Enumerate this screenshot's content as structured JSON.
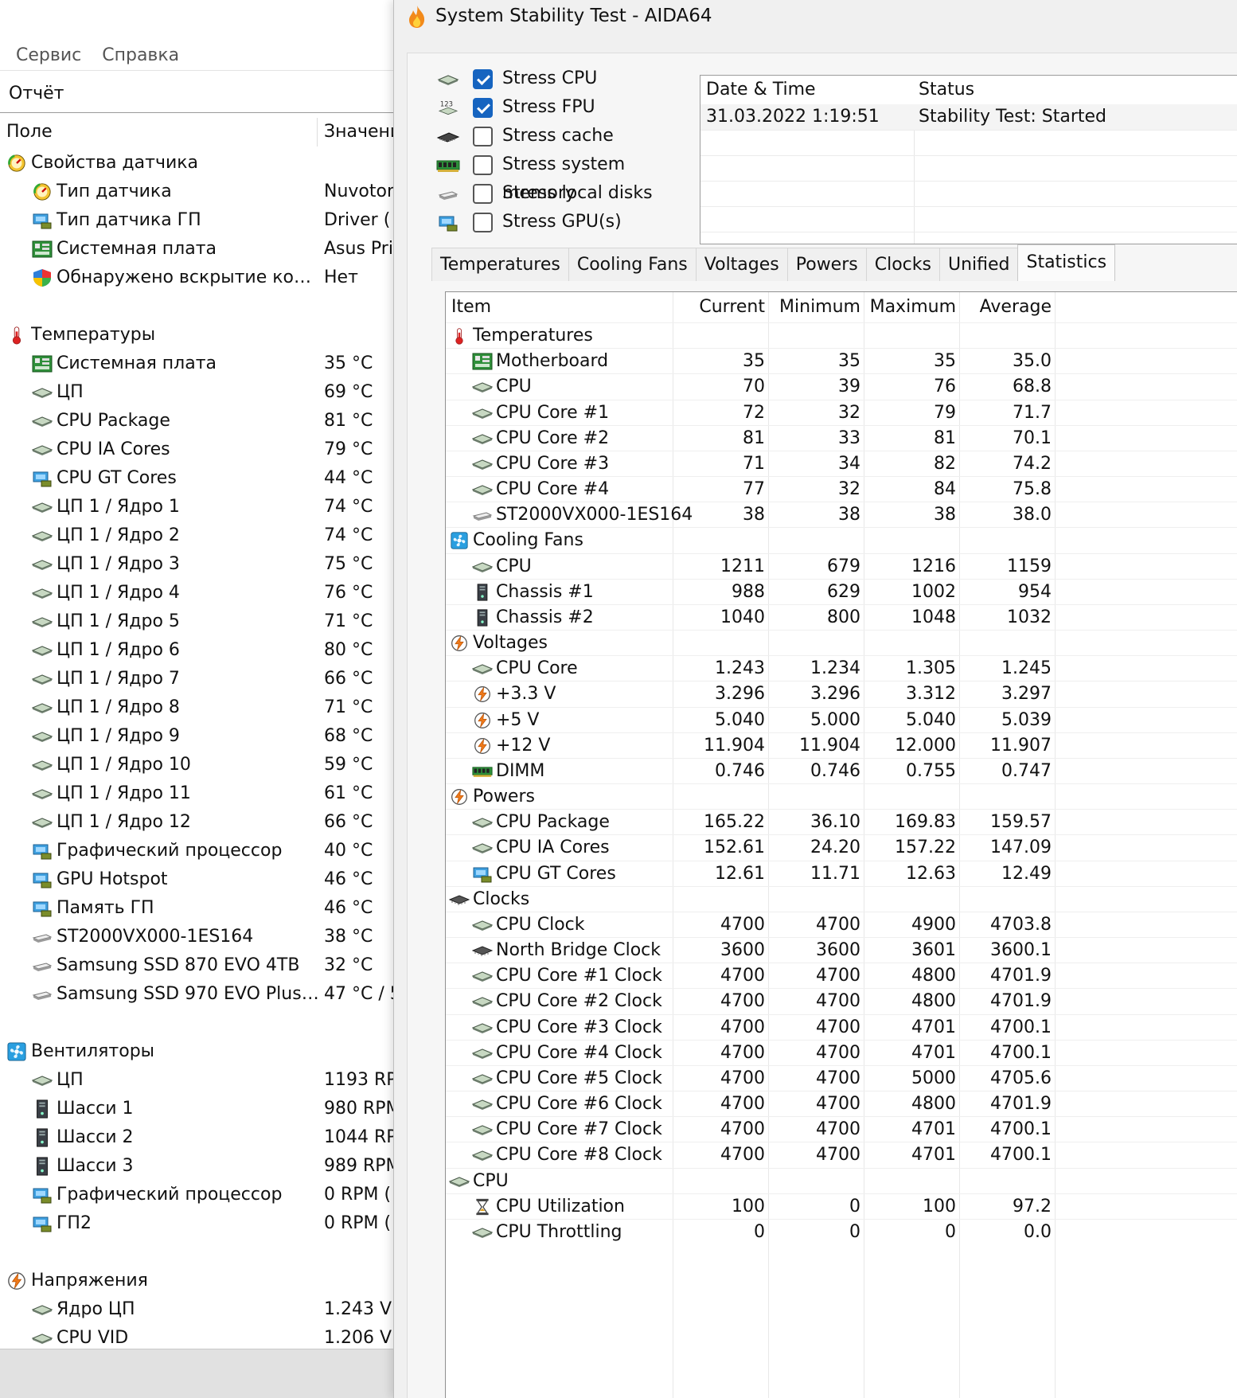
{
  "left": {
    "menu": [
      "Сервис",
      "Справка"
    ],
    "report_label": "Отчёт",
    "col_field": "Поле",
    "col_value": "Значени",
    "rows": [
      {
        "type": "group",
        "icon": "sensor-icon",
        "label": "Свойства датчика",
        "value": ""
      },
      {
        "type": "item",
        "icon": "sensor-icon",
        "label": "Тип датчика",
        "value": "Nuvoton"
      },
      {
        "type": "item",
        "icon": "gpu-icon",
        "label": "Тип датчика ГП",
        "value": "Driver  ("
      },
      {
        "type": "item",
        "icon": "motherboard-icon",
        "label": "Системная плата",
        "value": "Asus Pri"
      },
      {
        "type": "item",
        "icon": "shield-icon",
        "label": "Обнаружено вскрытие кор...",
        "value": "Нет"
      },
      {
        "type": "gap"
      },
      {
        "type": "group",
        "icon": "thermometer-icon",
        "label": "Температуры",
        "value": ""
      },
      {
        "type": "item",
        "icon": "motherboard-icon",
        "label": "Системная плата",
        "value": "35 °C"
      },
      {
        "type": "item",
        "icon": "cpu-icon",
        "label": "ЦП",
        "value": "69 °C"
      },
      {
        "type": "item",
        "icon": "cpu-icon",
        "label": "CPU Package",
        "value": "81 °C"
      },
      {
        "type": "item",
        "icon": "cpu-icon",
        "label": "CPU IA Cores",
        "value": "79 °C"
      },
      {
        "type": "item",
        "icon": "gpu-icon",
        "label": "CPU GT Cores",
        "value": "44 °C"
      },
      {
        "type": "item",
        "icon": "cpu-icon",
        "label": "ЦП 1 / Ядро 1",
        "value": "74 °C"
      },
      {
        "type": "item",
        "icon": "cpu-icon",
        "label": "ЦП 1 / Ядро 2",
        "value": "74 °C"
      },
      {
        "type": "item",
        "icon": "cpu-icon",
        "label": "ЦП 1 / Ядро 3",
        "value": "75 °C"
      },
      {
        "type": "item",
        "icon": "cpu-icon",
        "label": "ЦП 1 / Ядро 4",
        "value": "76 °C"
      },
      {
        "type": "item",
        "icon": "cpu-icon",
        "label": "ЦП 1 / Ядро 5",
        "value": "71 °C"
      },
      {
        "type": "item",
        "icon": "cpu-icon",
        "label": "ЦП 1 / Ядро 6",
        "value": "80 °C"
      },
      {
        "type": "item",
        "icon": "cpu-icon",
        "label": "ЦП 1 / Ядро 7",
        "value": "66 °C"
      },
      {
        "type": "item",
        "icon": "cpu-icon",
        "label": "ЦП 1 / Ядро 8",
        "value": "71 °C"
      },
      {
        "type": "item",
        "icon": "cpu-icon",
        "label": "ЦП 1 / Ядро 9",
        "value": "68 °C"
      },
      {
        "type": "item",
        "icon": "cpu-icon",
        "label": "ЦП 1 / Ядро 10",
        "value": "59 °C"
      },
      {
        "type": "item",
        "icon": "cpu-icon",
        "label": "ЦП 1 / Ядро 11",
        "value": "61 °C"
      },
      {
        "type": "item",
        "icon": "cpu-icon",
        "label": "ЦП 1 / Ядро 12",
        "value": "66 °C"
      },
      {
        "type": "item",
        "icon": "gpu-icon",
        "label": "Графический процессор",
        "value": "40 °C"
      },
      {
        "type": "item",
        "icon": "gpu-icon",
        "label": "GPU Hotspot",
        "value": "46 °C"
      },
      {
        "type": "item",
        "icon": "gpu-icon",
        "label": "Память ГП",
        "value": "46 °C"
      },
      {
        "type": "item",
        "icon": "disk-icon",
        "label": "ST2000VX000-1ES164",
        "value": "38 °C"
      },
      {
        "type": "item",
        "icon": "disk-icon",
        "label": "Samsung SSD 870 EVO 4TB",
        "value": "32 °C"
      },
      {
        "type": "item",
        "icon": "disk-icon",
        "label": "Samsung SSD 970 EVO Plus ...",
        "value": "47 °C / 5"
      },
      {
        "type": "gap"
      },
      {
        "type": "group",
        "icon": "fan-icon",
        "label": "Вентиляторы",
        "value": ""
      },
      {
        "type": "item",
        "icon": "cpu-icon",
        "label": "ЦП",
        "value": "1193 RP"
      },
      {
        "type": "item",
        "icon": "chassis-icon",
        "label": "Шасси 1",
        "value": "980 RPM"
      },
      {
        "type": "item",
        "icon": "chassis-icon",
        "label": "Шасси 2",
        "value": "1044 RP"
      },
      {
        "type": "item",
        "icon": "chassis-icon",
        "label": "Шасси 3",
        "value": "989 RPM"
      },
      {
        "type": "item",
        "icon": "gpu-icon",
        "label": "Графический процессор",
        "value": "0 RPM  ("
      },
      {
        "type": "item",
        "icon": "gpu-icon",
        "label": "ГП2",
        "value": "0 RPM  ("
      },
      {
        "type": "gap"
      },
      {
        "type": "group",
        "icon": "voltage-icon",
        "label": "Напряжения",
        "value": ""
      },
      {
        "type": "item",
        "icon": "cpu-icon",
        "label": "Ядро ЦП",
        "value": "1.243 V"
      },
      {
        "type": "item",
        "icon": "cpu-icon",
        "label": "CPU VID",
        "value": "1.206 V"
      }
    ]
  },
  "window": {
    "title": "System Stability Test - AIDA64",
    "stress": [
      {
        "icon": "cpu-icon",
        "label": "Stress CPU",
        "checked": true
      },
      {
        "icon": "fpu-icon",
        "label": "Stress FPU",
        "checked": true
      },
      {
        "icon": "cache-icon",
        "label": "Stress cache",
        "checked": false
      },
      {
        "icon": "memory-icon",
        "label": "Stress system memory",
        "checked": false
      },
      {
        "icon": "disk-icon",
        "label": "Stress local disks",
        "checked": false
      },
      {
        "icon": "gpu-icon",
        "label": "Stress GPU(s)",
        "checked": false
      }
    ],
    "log": {
      "col_datetime": "Date & Time",
      "col_status": "Status",
      "rows": [
        {
          "datetime": "31.03.2022 1:19:51",
          "status": "Stability Test: Started"
        }
      ]
    },
    "tabs": [
      "Temperatures",
      "Cooling Fans",
      "Voltages",
      "Powers",
      "Clocks",
      "Unified",
      "Statistics"
    ],
    "active_tab": "Statistics",
    "stats": {
      "headers": {
        "item": "Item",
        "current": "Current",
        "minimum": "Minimum",
        "maximum": "Maximum",
        "average": "Average"
      },
      "rows": [
        {
          "type": "group",
          "icon": "thermometer-icon",
          "label": "Temperatures"
        },
        {
          "type": "item",
          "icon": "motherboard-icon",
          "label": "Motherboard",
          "cur": "35",
          "min": "35",
          "max": "35",
          "avg": "35.0"
        },
        {
          "type": "item",
          "icon": "cpu-icon",
          "label": "CPU",
          "cur": "70",
          "min": "39",
          "max": "76",
          "avg": "68.8"
        },
        {
          "type": "item",
          "icon": "cpu-icon",
          "label": "CPU Core #1",
          "cur": "72",
          "min": "32",
          "max": "79",
          "avg": "71.7"
        },
        {
          "type": "item",
          "icon": "cpu-icon",
          "label": "CPU Core #2",
          "cur": "81",
          "min": "33",
          "max": "81",
          "avg": "70.1"
        },
        {
          "type": "item",
          "icon": "cpu-icon",
          "label": "CPU Core #3",
          "cur": "71",
          "min": "34",
          "max": "82",
          "avg": "74.2"
        },
        {
          "type": "item",
          "icon": "cpu-icon",
          "label": "CPU Core #4",
          "cur": "77",
          "min": "32",
          "max": "84",
          "avg": "75.8"
        },
        {
          "type": "item",
          "icon": "disk-icon",
          "label": "ST2000VX000-1ES164",
          "cur": "38",
          "min": "38",
          "max": "38",
          "avg": "38.0"
        },
        {
          "type": "group",
          "icon": "fan-icon",
          "label": "Cooling Fans"
        },
        {
          "type": "item",
          "icon": "cpu-icon",
          "label": "CPU",
          "cur": "1211",
          "min": "679",
          "max": "1216",
          "avg": "1159"
        },
        {
          "type": "item",
          "icon": "chassis-icon",
          "label": "Chassis #1",
          "cur": "988",
          "min": "629",
          "max": "1002",
          "avg": "954"
        },
        {
          "type": "item",
          "icon": "chassis-icon",
          "label": "Chassis #2",
          "cur": "1040",
          "min": "800",
          "max": "1048",
          "avg": "1032"
        },
        {
          "type": "group",
          "icon": "voltage-icon",
          "label": "Voltages"
        },
        {
          "type": "item",
          "icon": "cpu-icon",
          "label": "CPU Core",
          "cur": "1.243",
          "min": "1.234",
          "max": "1.305",
          "avg": "1.245"
        },
        {
          "type": "item",
          "icon": "voltage-icon",
          "label": "+3.3 V",
          "cur": "3.296",
          "min": "3.296",
          "max": "3.312",
          "avg": "3.297"
        },
        {
          "type": "item",
          "icon": "voltage-icon",
          "label": "+5 V",
          "cur": "5.040",
          "min": "5.000",
          "max": "5.040",
          "avg": "5.039"
        },
        {
          "type": "item",
          "icon": "voltage-icon",
          "label": "+12 V",
          "cur": "11.904",
          "min": "11.904",
          "max": "12.000",
          "avg": "11.907"
        },
        {
          "type": "item",
          "icon": "memory-icon",
          "label": "DIMM",
          "cur": "0.746",
          "min": "0.746",
          "max": "0.755",
          "avg": "0.747"
        },
        {
          "type": "group",
          "icon": "voltage-icon",
          "label": "Powers"
        },
        {
          "type": "item",
          "icon": "cpu-icon",
          "label": "CPU Package",
          "cur": "165.22",
          "min": "36.10",
          "max": "169.83",
          "avg": "159.57"
        },
        {
          "type": "item",
          "icon": "cpu-icon",
          "label": "CPU IA Cores",
          "cur": "152.61",
          "min": "24.20",
          "max": "157.22",
          "avg": "147.09"
        },
        {
          "type": "item",
          "icon": "gpu-icon",
          "label": "CPU GT Cores",
          "cur": "12.61",
          "min": "11.71",
          "max": "12.63",
          "avg": "12.49"
        },
        {
          "type": "group",
          "icon": "chip-icon",
          "label": "Clocks"
        },
        {
          "type": "item",
          "icon": "cpu-icon",
          "label": "CPU Clock",
          "cur": "4700",
          "min": "4700",
          "max": "4900",
          "avg": "4703.8"
        },
        {
          "type": "item",
          "icon": "chip-icon",
          "label": "North Bridge Clock",
          "cur": "3600",
          "min": "3600",
          "max": "3601",
          "avg": "3600.1"
        },
        {
          "type": "item",
          "icon": "cpu-icon",
          "label": "CPU Core #1 Clock",
          "cur": "4700",
          "min": "4700",
          "max": "4800",
          "avg": "4701.9"
        },
        {
          "type": "item",
          "icon": "cpu-icon",
          "label": "CPU Core #2 Clock",
          "cur": "4700",
          "min": "4700",
          "max": "4800",
          "avg": "4701.9"
        },
        {
          "type": "item",
          "icon": "cpu-icon",
          "label": "CPU Core #3 Clock",
          "cur": "4700",
          "min": "4700",
          "max": "4701",
          "avg": "4700.1"
        },
        {
          "type": "item",
          "icon": "cpu-icon",
          "label": "CPU Core #4 Clock",
          "cur": "4700",
          "min": "4700",
          "max": "4701",
          "avg": "4700.1"
        },
        {
          "type": "item",
          "icon": "cpu-icon",
          "label": "CPU Core #5 Clock",
          "cur": "4700",
          "min": "4700",
          "max": "5000",
          "avg": "4705.6"
        },
        {
          "type": "item",
          "icon": "cpu-icon",
          "label": "CPU Core #6 Clock",
          "cur": "4700",
          "min": "4700",
          "max": "4800",
          "avg": "4701.9"
        },
        {
          "type": "item",
          "icon": "cpu-icon",
          "label": "CPU Core #7 Clock",
          "cur": "4700",
          "min": "4700",
          "max": "4701",
          "avg": "4700.1"
        },
        {
          "type": "item",
          "icon": "cpu-icon",
          "label": "CPU Core #8 Clock",
          "cur": "4700",
          "min": "4700",
          "max": "4701",
          "avg": "4700.1"
        },
        {
          "type": "group",
          "icon": "cpu-icon",
          "label": "CPU"
        },
        {
          "type": "item",
          "icon": "hourglass-icon",
          "label": "CPU Utilization",
          "cur": "100",
          "min": "0",
          "max": "100",
          "avg": "97.2"
        },
        {
          "type": "item",
          "icon": "cpu-icon",
          "label": "CPU Throttling",
          "cur": "0",
          "min": "0",
          "max": "0",
          "avg": "0.0"
        }
      ]
    }
  }
}
